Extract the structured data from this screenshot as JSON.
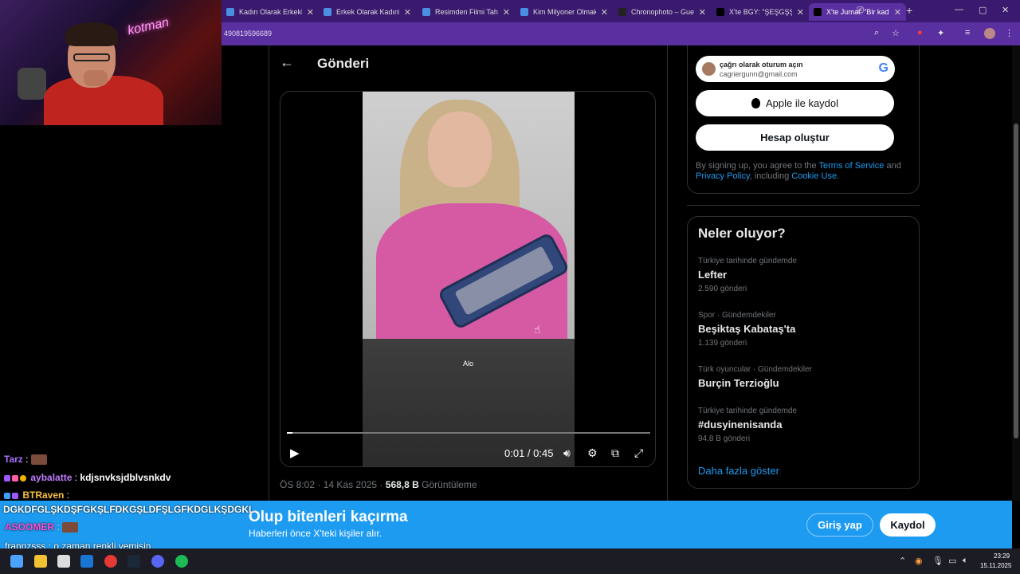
{
  "browser": {
    "tabs": [
      {
        "label": "Kadın Olarak Erkekle",
        "favicon_color": "#4a90e2"
      },
      {
        "label": "Erkek Olarak Kadınla",
        "favicon_color": "#4a90e2"
      },
      {
        "label": "Resimden Filmi Tahm",
        "favicon_color": "#4a90e2"
      },
      {
        "label": "Kim Milyoner Olmak",
        "favicon_color": "#4a90e2"
      },
      {
        "label": "Chronophoto – Gues",
        "favicon_color": "#222222"
      },
      {
        "label": "X'te BGY: \"ŞEŞGŞŞG",
        "favicon_color": "#000000"
      },
      {
        "label": "X'te Jurnal: \"Bir kadın",
        "favicon_color": "#000000"
      }
    ],
    "close_glyph": "✕",
    "new_tab_glyph": "+",
    "url": "490819596689",
    "window_controls": [
      "—",
      "▢",
      "✕"
    ]
  },
  "post": {
    "back_icon": "←",
    "title": "Gönderi",
    "video": {
      "caption": "Alo",
      "progress_fraction": 0.015,
      "time": "0:01 / 0:45",
      "play_icon": "▶",
      "controls": [
        "volume-icon",
        "settings-icon",
        "dock-icon",
        "fullscreen-icon"
      ]
    },
    "meta": {
      "time": "ÖS 8:02",
      "date": "14 Kas 2025",
      "views_count": "568,8 B",
      "views_label": "Görüntüleme"
    }
  },
  "signup": {
    "google_title": "çağrı olarak oturum açın",
    "google_email": "cagriergunn@gmail.com",
    "apple_label": "Apple ile kaydol",
    "create_label": "Hesap oluştur",
    "terms_prefix": "By signing up, you agree to the ",
    "terms_link": "Terms of Service",
    "terms_and": " and ",
    "privacy_link": "Privacy Policy",
    "terms_including": ", including ",
    "cookie_link": "Cookie Use."
  },
  "trends": {
    "title": "Neler oluyor?",
    "items": [
      {
        "context": "Türkiye tarihinde gündemde",
        "name": "Lefter",
        "count": "2.590 gönderi"
      },
      {
        "context": "Spor · Gündemdekiler",
        "name": "Beşiktaş Kabataş'ta",
        "count": "1.139 gönderi"
      },
      {
        "context": "Türk oyuncular · Gündemdekiler",
        "name": "Burçin Terzioğlu",
        "count": ""
      },
      {
        "context": "Türkiye tarihinde gündemde",
        "name": "#dusyinenisanda",
        "count": "94,8 B gönderi"
      }
    ],
    "show_more": "Daha fazla göster"
  },
  "banner": {
    "title": "Olup bitenleri kaçırma",
    "subtitle": "Haberleri önce X'teki kişiler alır.",
    "login": "Giriş yap",
    "signup": "Kaydol"
  },
  "chat": [
    {
      "user": "Tarz",
      "user_color": "#a970ff",
      "sep": " :",
      "message": ""
    },
    {
      "user": "aybalatte",
      "user_color": "#c07cff",
      "sep": " : ",
      "message": "kdjsnvksjdblvsnkdv"
    },
    {
      "user": "BTRaven",
      "user_color": "#f6c244",
      "sep": " :",
      "message": ""
    },
    {
      "user": "",
      "user_color": "#ffffff",
      "sep": "",
      "message": "DGKDFGLŞKDŞFGKŞLFDKGŞLDFŞLGFKDGLKŞDGKL"
    },
    {
      "user": "ASOOMER",
      "user_color": "#ff4fd8",
      "sep": " :",
      "message": ""
    },
    {
      "user": "frannzsss",
      "user_color": "#ffffff",
      "sep": " : ",
      "message": "o zaman renkli yemisin"
    }
  ],
  "webcam": {
    "neon_text": "kotman"
  },
  "taskbar": {
    "time": "23:29",
    "date": "15.11.2025",
    "apps": [
      "windows-start",
      "file-explorer",
      "store",
      "outlook",
      "chrome",
      "steam",
      "discord",
      "spotify"
    ]
  }
}
